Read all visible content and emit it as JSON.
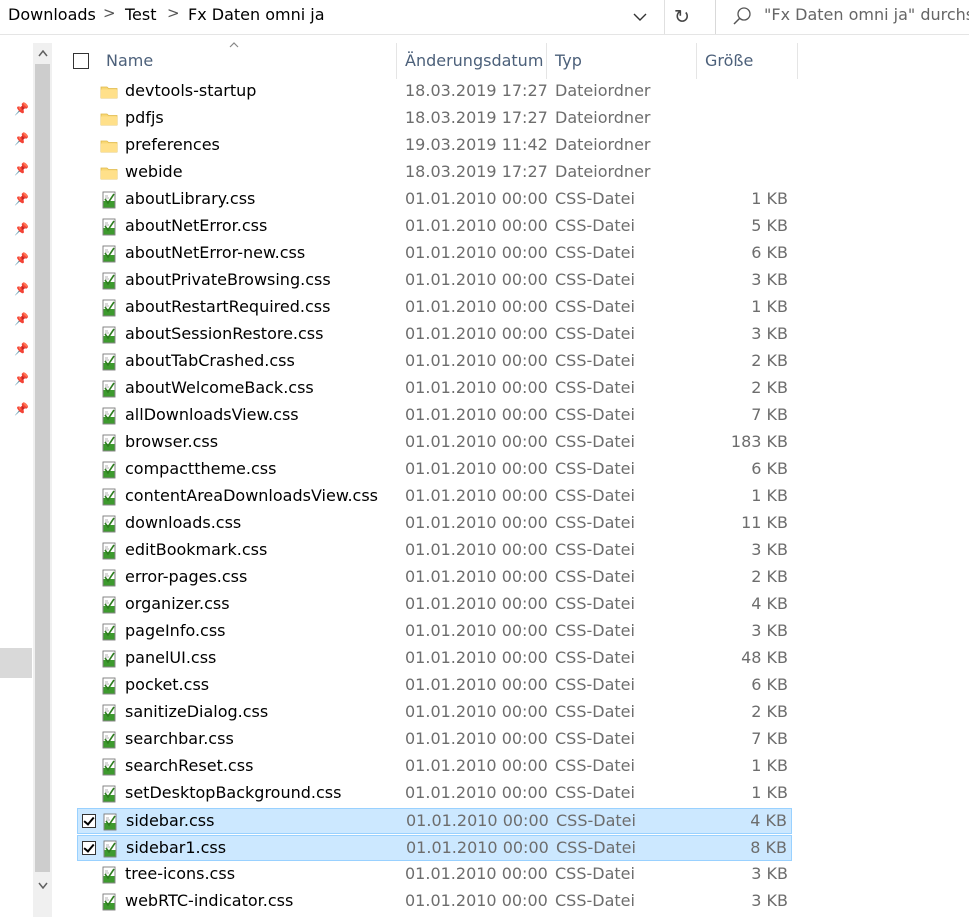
{
  "breadcrumb": {
    "items": [
      "Downloads",
      "Test",
      "Fx Daten omni ja"
    ],
    "separator": ">"
  },
  "search": {
    "placeholder": "\"Fx Daten omni ja\" durchsuchen"
  },
  "columns": {
    "name": "Name",
    "modified": "Änderungsdatum",
    "type": "Typ",
    "size": "Größe"
  },
  "icons": {
    "folder": "folder-icon",
    "css": "css-file-icon"
  },
  "colors": {
    "selection_bg": "#cce8ff",
    "selection_border": "#99d1ff",
    "header_text": "#4c607a",
    "folder_yellow": "#f8d775"
  },
  "rows": [
    {
      "name": "devtools-startup",
      "date": "18.03.2019 17:27",
      "type": "Dateiordner",
      "size": "",
      "kind": "folder",
      "selected": false
    },
    {
      "name": "pdfjs",
      "date": "18.03.2019 17:27",
      "type": "Dateiordner",
      "size": "",
      "kind": "folder",
      "selected": false
    },
    {
      "name": "preferences",
      "date": "19.03.2019 11:42",
      "type": "Dateiordner",
      "size": "",
      "kind": "folder",
      "selected": false
    },
    {
      "name": "webide",
      "date": "18.03.2019 17:27",
      "type": "Dateiordner",
      "size": "",
      "kind": "folder",
      "selected": false
    },
    {
      "name": "aboutLibrary.css",
      "date": "01.01.2010 00:00",
      "type": "CSS-Datei",
      "size": "1 KB",
      "kind": "css",
      "selected": false
    },
    {
      "name": "aboutNetError.css",
      "date": "01.01.2010 00:00",
      "type": "CSS-Datei",
      "size": "5 KB",
      "kind": "css",
      "selected": false
    },
    {
      "name": "aboutNetError-new.css",
      "date": "01.01.2010 00:00",
      "type": "CSS-Datei",
      "size": "6 KB",
      "kind": "css",
      "selected": false
    },
    {
      "name": "aboutPrivateBrowsing.css",
      "date": "01.01.2010 00:00",
      "type": "CSS-Datei",
      "size": "3 KB",
      "kind": "css",
      "selected": false
    },
    {
      "name": "aboutRestartRequired.css",
      "date": "01.01.2010 00:00",
      "type": "CSS-Datei",
      "size": "1 KB",
      "kind": "css",
      "selected": false
    },
    {
      "name": "aboutSessionRestore.css",
      "date": "01.01.2010 00:00",
      "type": "CSS-Datei",
      "size": "3 KB",
      "kind": "css",
      "selected": false
    },
    {
      "name": "aboutTabCrashed.css",
      "date": "01.01.2010 00:00",
      "type": "CSS-Datei",
      "size": "2 KB",
      "kind": "css",
      "selected": false
    },
    {
      "name": "aboutWelcomeBack.css",
      "date": "01.01.2010 00:00",
      "type": "CSS-Datei",
      "size": "2 KB",
      "kind": "css",
      "selected": false
    },
    {
      "name": "allDownloadsView.css",
      "date": "01.01.2010 00:00",
      "type": "CSS-Datei",
      "size": "7 KB",
      "kind": "css",
      "selected": false
    },
    {
      "name": "browser.css",
      "date": "01.01.2010 00:00",
      "type": "CSS-Datei",
      "size": "183 KB",
      "kind": "css",
      "selected": false
    },
    {
      "name": "compacttheme.css",
      "date": "01.01.2010 00:00",
      "type": "CSS-Datei",
      "size": "6 KB",
      "kind": "css",
      "selected": false
    },
    {
      "name": "contentAreaDownloadsView.css",
      "date": "01.01.2010 00:00",
      "type": "CSS-Datei",
      "size": "1 KB",
      "kind": "css",
      "selected": false
    },
    {
      "name": "downloads.css",
      "date": "01.01.2010 00:00",
      "type": "CSS-Datei",
      "size": "11 KB",
      "kind": "css",
      "selected": false
    },
    {
      "name": "editBookmark.css",
      "date": "01.01.2010 00:00",
      "type": "CSS-Datei",
      "size": "3 KB",
      "kind": "css",
      "selected": false
    },
    {
      "name": "error-pages.css",
      "date": "01.01.2010 00:00",
      "type": "CSS-Datei",
      "size": "2 KB",
      "kind": "css",
      "selected": false
    },
    {
      "name": "organizer.css",
      "date": "01.01.2010 00:00",
      "type": "CSS-Datei",
      "size": "4 KB",
      "kind": "css",
      "selected": false
    },
    {
      "name": "pageInfo.css",
      "date": "01.01.2010 00:00",
      "type": "CSS-Datei",
      "size": "3 KB",
      "kind": "css",
      "selected": false
    },
    {
      "name": "panelUI.css",
      "date": "01.01.2010 00:00",
      "type": "CSS-Datei",
      "size": "48 KB",
      "kind": "css",
      "selected": false
    },
    {
      "name": "pocket.css",
      "date": "01.01.2010 00:00",
      "type": "CSS-Datei",
      "size": "6 KB",
      "kind": "css",
      "selected": false
    },
    {
      "name": "sanitizeDialog.css",
      "date": "01.01.2010 00:00",
      "type": "CSS-Datei",
      "size": "2 KB",
      "kind": "css",
      "selected": false
    },
    {
      "name": "searchbar.css",
      "date": "01.01.2010 00:00",
      "type": "CSS-Datei",
      "size": "7 KB",
      "kind": "css",
      "selected": false
    },
    {
      "name": "searchReset.css",
      "date": "01.01.2010 00:00",
      "type": "CSS-Datei",
      "size": "1 KB",
      "kind": "css",
      "selected": false
    },
    {
      "name": "setDesktopBackground.css",
      "date": "01.01.2010 00:00",
      "type": "CSS-Datei",
      "size": "1 KB",
      "kind": "css",
      "selected": false
    },
    {
      "name": "sidebar.css",
      "date": "01.01.2010 00:00",
      "type": "CSS-Datei",
      "size": "4 KB",
      "kind": "css",
      "selected": true
    },
    {
      "name": "sidebar1.css",
      "date": "01.01.2010 00:00",
      "type": "CSS-Datei",
      "size": "8 KB",
      "kind": "css",
      "selected": true
    },
    {
      "name": "tree-icons.css",
      "date": "01.01.2010 00:00",
      "type": "CSS-Datei",
      "size": "3 KB",
      "kind": "css",
      "selected": false
    },
    {
      "name": "webRTC-indicator.css",
      "date": "01.01.2010 00:00",
      "type": "CSS-Datei",
      "size": "3 KB",
      "kind": "css",
      "selected": false
    }
  ]
}
